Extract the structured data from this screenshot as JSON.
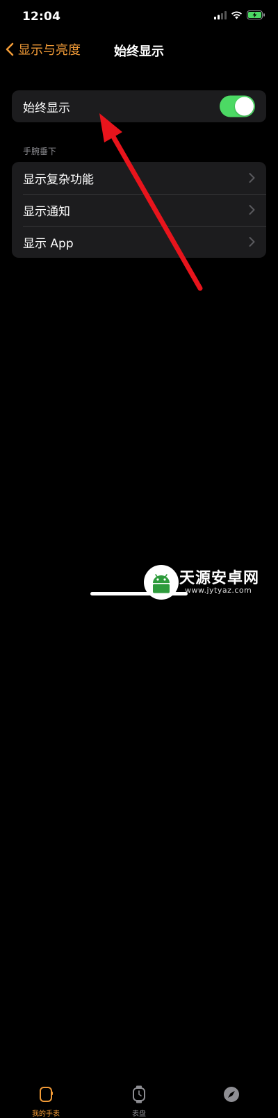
{
  "status": {
    "time": "12:04"
  },
  "nav": {
    "back_label": "显示与亮度",
    "title": "始终显示"
  },
  "always_on": {
    "label": "始终显示",
    "enabled": true
  },
  "wrist_down": {
    "header": "手腕垂下",
    "items": [
      {
        "label": "显示复杂功能"
      },
      {
        "label": "显示通知"
      },
      {
        "label": "显示 App"
      }
    ]
  },
  "tabs": [
    {
      "label": "我的手表",
      "icon": "watch-face-icon",
      "active": true
    },
    {
      "label": "表盘",
      "icon": "watch-icon",
      "active": false
    },
    {
      "label": "",
      "icon": "compass-icon",
      "active": false
    }
  ],
  "watermark": {
    "name": "天源安卓网",
    "url": "www.jytyaz.com"
  },
  "colors": {
    "accent": "#f29b37",
    "toggle_on": "#4cd964",
    "cell_bg": "#1c1c1e",
    "annotation": "#e8141c"
  }
}
